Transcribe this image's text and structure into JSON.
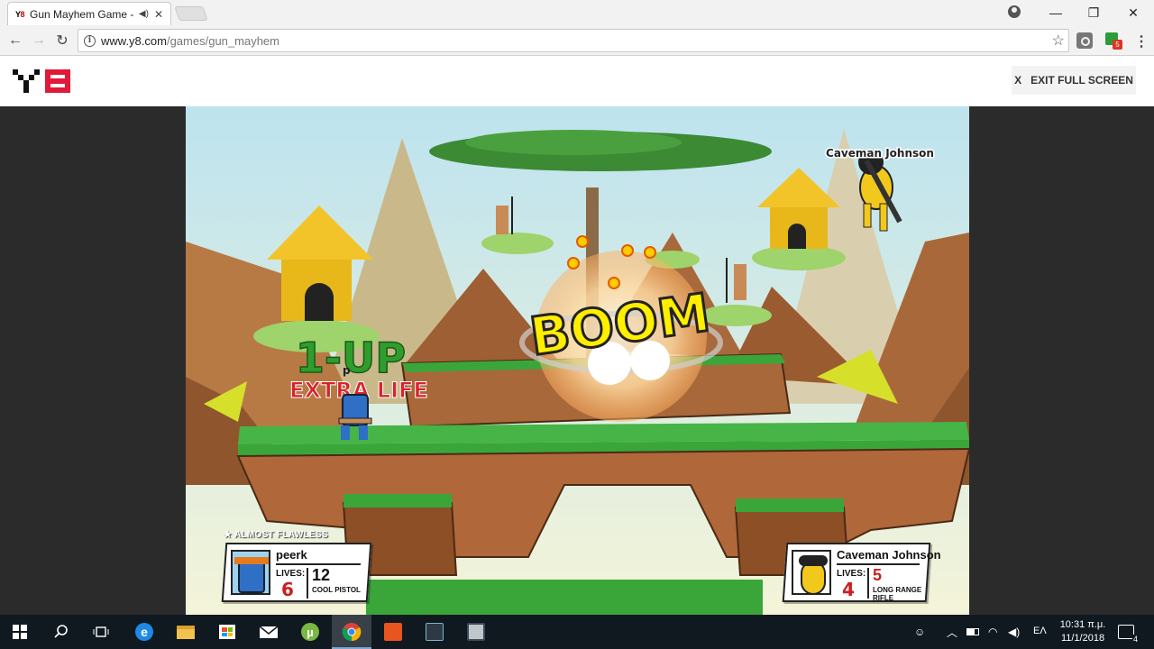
{
  "browser": {
    "tab": {
      "favicon_text": "Y8",
      "title": "Gun Mayhem Game -",
      "audio_icon": "speaker-icon",
      "close_glyph": "✕"
    },
    "window_controls": {
      "minimize": "—",
      "restore": "❐",
      "close": "✕"
    },
    "toolbar": {
      "back_glyph": "←",
      "forward_glyph": "→",
      "reload_glyph": "↻",
      "info_glyph": "i",
      "url_domain": "www.y8.com",
      "url_path": "/games/gun_mayhem",
      "star_glyph": "☆",
      "extension_badge": "5",
      "menu_glyph": "⋮"
    }
  },
  "site": {
    "logo_text": "Y8",
    "exit_fullscreen": {
      "x_glyph": "X",
      "label": "EXIT FULL SCREEN"
    }
  },
  "game": {
    "effects": {
      "boom": "BOOM",
      "one_up": "1-UP",
      "extra_life": "EXTRA LIFE"
    },
    "player_tags": {
      "player1_short": "p",
      "player2": "Caveman Johnson"
    },
    "rank_label": "ALMOST FLAWLESS",
    "players": [
      {
        "name": "peerk",
        "lives_label": "LIVES:",
        "lives": "6",
        "ammo": "12",
        "weapon": "COOL PISTOL",
        "color": "#2f6fc6"
      },
      {
        "name": "Caveman Johnson",
        "lives_label": "LIVES:",
        "lives": "4",
        "ammo": "5",
        "weapon": "LONG RANGE RIFLE",
        "color": "#f2c81c"
      }
    ]
  },
  "taskbar": {
    "start_icon": "windows-start-icon",
    "apps": [
      "search-icon",
      "task-view-icon",
      "edge-icon",
      "file-explorer-icon",
      "store-icon",
      "mail-icon",
      "utorrent-icon",
      "chrome-icon",
      "app-orange-icon",
      "app-dark-icon",
      "app-disk-icon"
    ],
    "language": "ΕΛ",
    "time": "10:31 π.μ.",
    "date": "11/1/2018",
    "notification_count": "4"
  },
  "colors": {
    "sky": "#cfe9f0",
    "grass": "#3aa63a",
    "dirt": "#b0673a",
    "hut": "#e8b81a",
    "boom_yellow": "#ffee00",
    "extra_life_red": "#d8232a",
    "one_up_green": "#2f9d2c"
  }
}
